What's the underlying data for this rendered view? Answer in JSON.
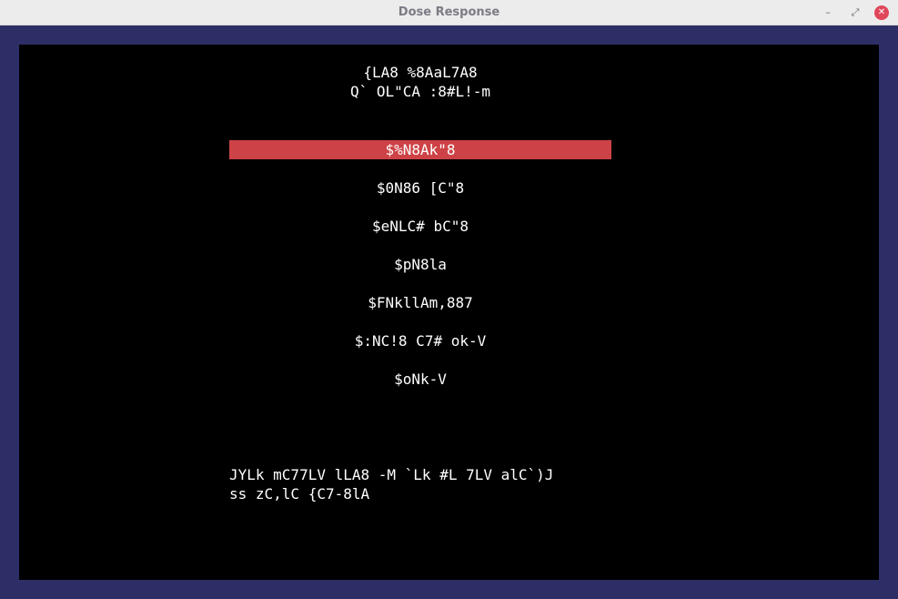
{
  "window": {
    "title": "Dose Response",
    "minimize_glyph": "–",
    "maximize_glyph": "⤢",
    "close_glyph": "✕"
  },
  "header": {
    "line1": "{LA8 %8AaL7A8",
    "line2": "Q` OL\"CA :8#L!-m"
  },
  "menu": {
    "items": [
      {
        "label": "$%N8Ak\"8",
        "selected": true
      },
      {
        "label": "$0N86 [C\"8",
        "selected": false
      },
      {
        "label": "$eNLC# bC\"8",
        "selected": false
      },
      {
        "label": "$pN8la",
        "selected": false
      },
      {
        "label": "$FNkllAm,887",
        "selected": false
      },
      {
        "label": "$:NC!8 C7# ok-V",
        "selected": false
      },
      {
        "label": "$oNk-V",
        "selected": false
      }
    ]
  },
  "footer": {
    "line1": "JYLk mC77LV lLA8 -M `Lk #L 7LV alC`)J",
    "line2": "ss zC,lC {C7-8lA"
  },
  "colors": {
    "selection": "#cd4246",
    "terminal_bg": "#000000",
    "frame": "#2e2e66"
  }
}
